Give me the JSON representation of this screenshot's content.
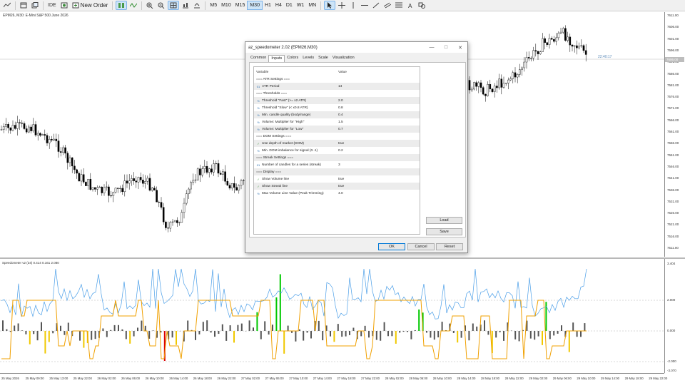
{
  "toolbar": {
    "ide_label": "IDE",
    "new_order_label": "New Order",
    "timeframes": [
      "M5",
      "M10",
      "M15",
      "M30",
      "H1",
      "H4",
      "D1",
      "W1",
      "MN"
    ],
    "active_timeframe": "M30"
  },
  "chart": {
    "info": "EPM26, M30:  E-Mini S&P 500 June 2026",
    "countdown": "22:40:17",
    "price_tag": "7606.00",
    "price_labels": [
      "7611.00",
      "7606.00",
      "7601.00",
      "7596.00",
      "7591.00",
      "7586.00",
      "7581.00",
      "7576.00",
      "7571.00",
      "7566.00",
      "7561.00",
      "7556.00",
      "7551.00",
      "7546.00",
      "7541.00",
      "7536.00",
      "7531.00",
      "7526.00",
      "7521.00",
      "7516.00",
      "7511.00"
    ]
  },
  "indicator": {
    "title": "Speedometer v2 (34)  0.414 0.161 2.080",
    "axis_labels": [
      "3.404",
      "2.000",
      "0.000",
      "-2.000",
      "-3.070"
    ]
  },
  "time_axis": {
    "labels": [
      "25 May 2026",
      "25 May 09:00",
      "25 May 13:00",
      "25 May 22:00",
      "26 May 02:00",
      "26 May 06:00",
      "26 May 10:00",
      "26 May 14:00",
      "26 May 18:00",
      "26 May 22:00",
      "27 May 02:00",
      "27 May 06:00",
      "27 May 10:00",
      "27 May 14:00",
      "27 May 18:00",
      "27 May 22:00",
      "28 May 02:00",
      "28 May 06:00",
      "28 May 10:00",
      "28 May 14:00",
      "28 May 18:00",
      "28 May 22:00",
      "29 May 02:00",
      "29 May 06:00",
      "29 May 10:00",
      "29 May 14:00",
      "29 May 18:00",
      "29 May 22:00"
    ]
  },
  "dialog": {
    "title": "az_speedometer 2.02 (EPM26,M30)",
    "tabs": [
      "Common",
      "Inputs",
      "Colors",
      "Levels",
      "Scale",
      "Visualization"
    ],
    "active_tab": "Inputs",
    "columns": {
      "variable": "Variable",
      "value": "Value"
    },
    "params": [
      {
        "name": "=== ATR Settings ===",
        "value": "",
        "icon": ""
      },
      {
        "name": "ATR Period",
        "value": "14",
        "icon": "int"
      },
      {
        "name": "=== Thresholds ===",
        "value": "",
        "icon": ""
      },
      {
        "name": "Threshold \"Fast\" (>= x2 ATR)",
        "value": "2.0",
        "icon": "dbl"
      },
      {
        "name": "Threshold \"Slow\" (< x0.8 ATR)",
        "value": "0.8",
        "icon": "dbl"
      },
      {
        "name": "Min. candle quality (body/range)",
        "value": "0.4",
        "icon": "dbl"
      },
      {
        "name": "Volume: Multiplier for \"High\"",
        "value": "1.5",
        "icon": "dbl"
      },
      {
        "name": "Volume: Multiplier for \"Low\"",
        "value": "0.7",
        "icon": "dbl"
      },
      {
        "name": "=== DOM Settings ===",
        "value": "",
        "icon": ""
      },
      {
        "name": "Use depth of market (DOM)",
        "value": "true",
        "icon": "bool"
      },
      {
        "name": "Min. DOM imbalance for signal (0..1)",
        "value": "0.2",
        "icon": "dbl"
      },
      {
        "name": "=== Streak Settings ===",
        "value": "",
        "icon": ""
      },
      {
        "name": "Number of candles for a series (streak)",
        "value": "3",
        "icon": "int"
      },
      {
        "name": "=== Display ===",
        "value": "",
        "icon": ""
      },
      {
        "name": "Show Volume line",
        "value": "true",
        "icon": "bool"
      },
      {
        "name": "Show Streak line",
        "value": "true",
        "icon": "bool"
      },
      {
        "name": "Max Volume Line Value (Peak Trimming)",
        "value": "4.0",
        "icon": "dbl"
      }
    ],
    "buttons": {
      "load": "Load",
      "save": "Save",
      "ok": "OK",
      "cancel": "Cancel",
      "reset": "Reset"
    }
  },
  "colors": {
    "candle": "#000000",
    "volume_line": "#4a9ee8",
    "streak_line": "#f0a000",
    "hist_gray": "#555555",
    "hist_green": "#00c800",
    "hist_yellow": "#f0c800",
    "hist_red": "#dc0000",
    "accent": "#0078d7"
  }
}
